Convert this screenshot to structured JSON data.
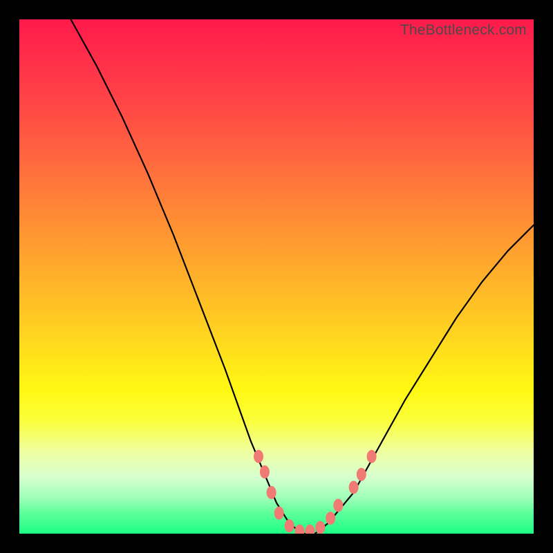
{
  "watermark": "TheBottleneck.com",
  "chart_data": {
    "type": "line",
    "title": "",
    "xlabel": "",
    "ylabel": "",
    "xlim": [
      0,
      100
    ],
    "ylim": [
      0,
      100
    ],
    "series": [
      {
        "name": "bottleneck-curve",
        "x": [
          10,
          15,
          20,
          25,
          30,
          35,
          40,
          45,
          47.5,
          50,
          52.5,
          55,
          57.5,
          60,
          65,
          70,
          75,
          80,
          85,
          90,
          95,
          100
        ],
        "values": [
          100,
          91,
          81,
          70,
          58,
          45,
          32,
          18,
          12,
          6,
          2,
          0,
          0,
          2,
          8,
          17,
          26,
          34,
          42,
          49,
          55,
          60
        ]
      }
    ],
    "annotations": {
      "beads": [
        {
          "x": 46.5,
          "y": 15
        },
        {
          "x": 47.7,
          "y": 12
        },
        {
          "x": 49.0,
          "y": 8
        },
        {
          "x": 50.5,
          "y": 4
        },
        {
          "x": 52.5,
          "y": 1.5
        },
        {
          "x": 54.5,
          "y": 0.5
        },
        {
          "x": 56.5,
          "y": 0.5
        },
        {
          "x": 58.5,
          "y": 1.2
        },
        {
          "x": 60.5,
          "y": 3
        },
        {
          "x": 62.0,
          "y": 5.5
        },
        {
          "x": 65.0,
          "y": 9
        },
        {
          "x": 66.5,
          "y": 11.5
        },
        {
          "x": 68.5,
          "y": 15
        }
      ]
    }
  }
}
